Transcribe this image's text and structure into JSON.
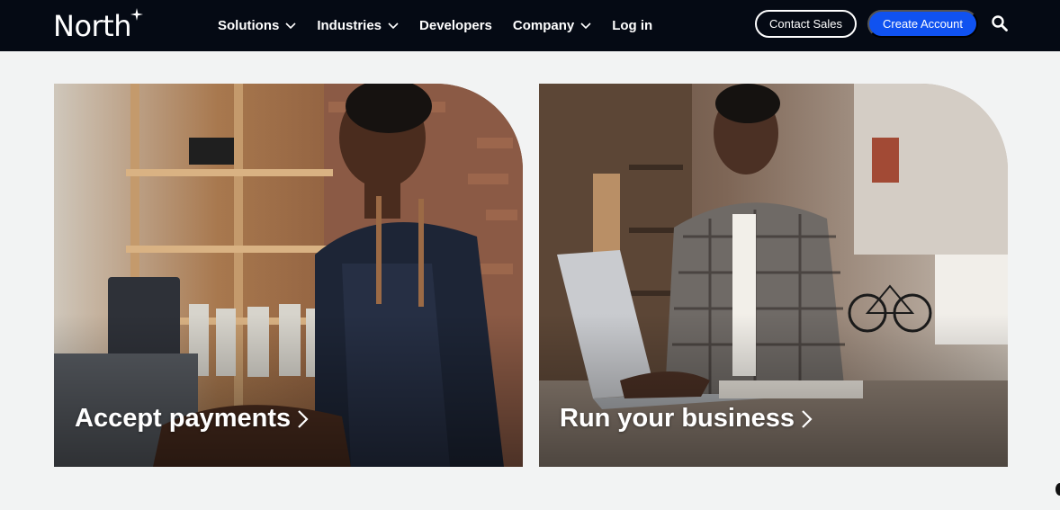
{
  "header": {
    "logo": "North",
    "nav": [
      {
        "label": "Solutions",
        "has_dropdown": true
      },
      {
        "label": "Industries",
        "has_dropdown": true
      },
      {
        "label": "Developers",
        "has_dropdown": false
      },
      {
        "label": "Company",
        "has_dropdown": true
      },
      {
        "label": "Log in",
        "has_dropdown": false
      }
    ],
    "contact_label": "Contact Sales",
    "create_label": "Create Account",
    "search_icon": "search-icon"
  },
  "cards": [
    {
      "label": "Accept payments",
      "icon": "chevron-right-icon",
      "photo": "smiling barista with glasses and apron at store counter"
    },
    {
      "label": "Run your business",
      "icon": "chevron-right-icon",
      "photo": "man in plaid shirt typing on laptop in workshop"
    }
  ],
  "colors": {
    "nav_bg": "#050a14",
    "accent": "#1052f0",
    "page_bg": "#f2f3f3"
  }
}
